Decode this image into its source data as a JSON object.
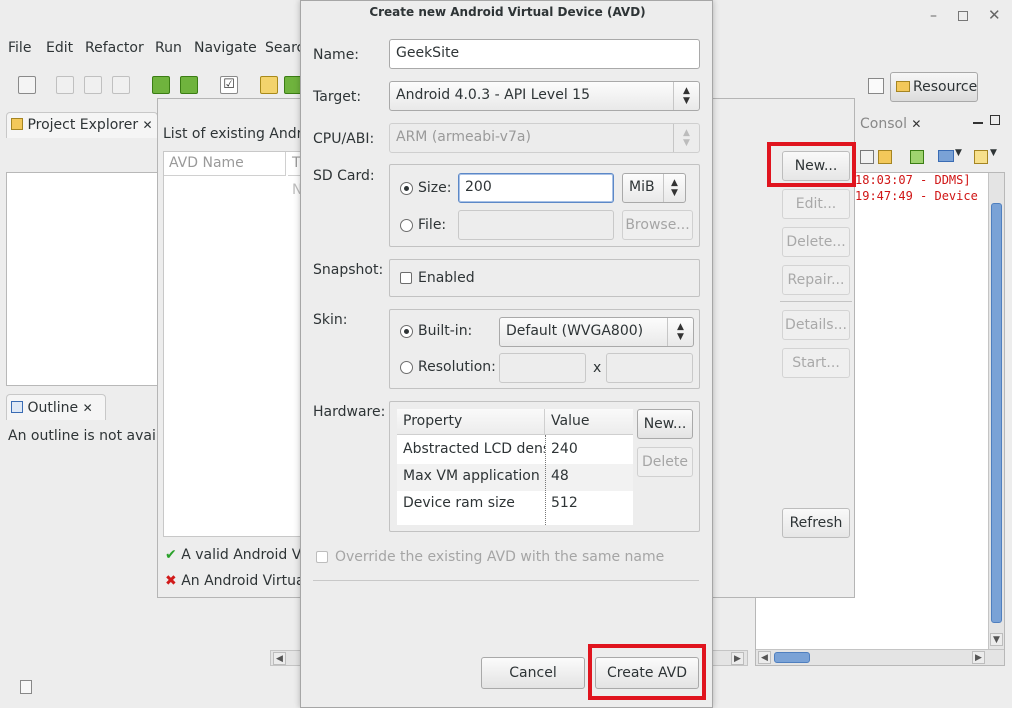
{
  "eclipse": {
    "menu": [
      "File",
      "Edit",
      "Refactor",
      "Run",
      "Navigate",
      "Searc"
    ],
    "perspective_label": "Resource",
    "project_explorer_tab": "Project Explorer",
    "outline_tab": "Outline",
    "outline_message": "An outline is not availal",
    "console_tab": "Consol",
    "console_lines": [
      "18:03:07 - DDMS]",
      "19:47:49 - Device"
    ]
  },
  "avd_manager": {
    "list_label": "List of existing Androi",
    "columns": [
      "AVD Name",
      "T"
    ],
    "col_overflow": "N",
    "buttons": {
      "new": "New...",
      "edit": "Edit...",
      "delete": "Delete...",
      "repair": "Repair...",
      "details": "Details...",
      "start": "Start...",
      "refresh": "Refresh"
    },
    "legend": [
      {
        "icon": "check",
        "text": "A valid Android Vi"
      },
      {
        "icon": "cross",
        "text": "An Android Virtua"
      }
    ]
  },
  "dialog": {
    "title": "Create new Android Virtual Device (AVD)",
    "name_label": "Name:",
    "name_value": "GeekSite",
    "target_label": "Target:",
    "target_value": "Android 4.0.3 - API Level 15",
    "cpu_label": "CPU/ABI:",
    "cpu_value": "ARM (armeabi-v7a)",
    "sdcard_label": "SD Card:",
    "size_label": "Size:",
    "size_value": "200",
    "size_unit": "MiB",
    "file_label": "File:",
    "browse_label": "Browse...",
    "snapshot_label": "Snapshot:",
    "enabled_label": "Enabled",
    "skin_label": "Skin:",
    "builtin_label": "Built-in:",
    "builtin_value": "Default (WVGA800)",
    "resolution_label": "Resolution:",
    "resolution_sep": "x",
    "hardware_label": "Hardware:",
    "hw_columns": [
      "Property",
      "Value"
    ],
    "hw_rows": [
      {
        "property": "Abstracted LCD densi",
        "value": "240"
      },
      {
        "property": "Max VM application he",
        "value": "48"
      },
      {
        "property": "Device ram size",
        "value": "512"
      }
    ],
    "hw_new": "New...",
    "hw_delete": "Delete",
    "override_label": "Override the existing AVD with the same name",
    "cancel": "Cancel",
    "create": "Create AVD"
  },
  "colors": {
    "highlight": "#e0141e",
    "console_text": "#d01515",
    "valid_check": "#2aa12a",
    "invalid_cross": "#d11a1a"
  }
}
